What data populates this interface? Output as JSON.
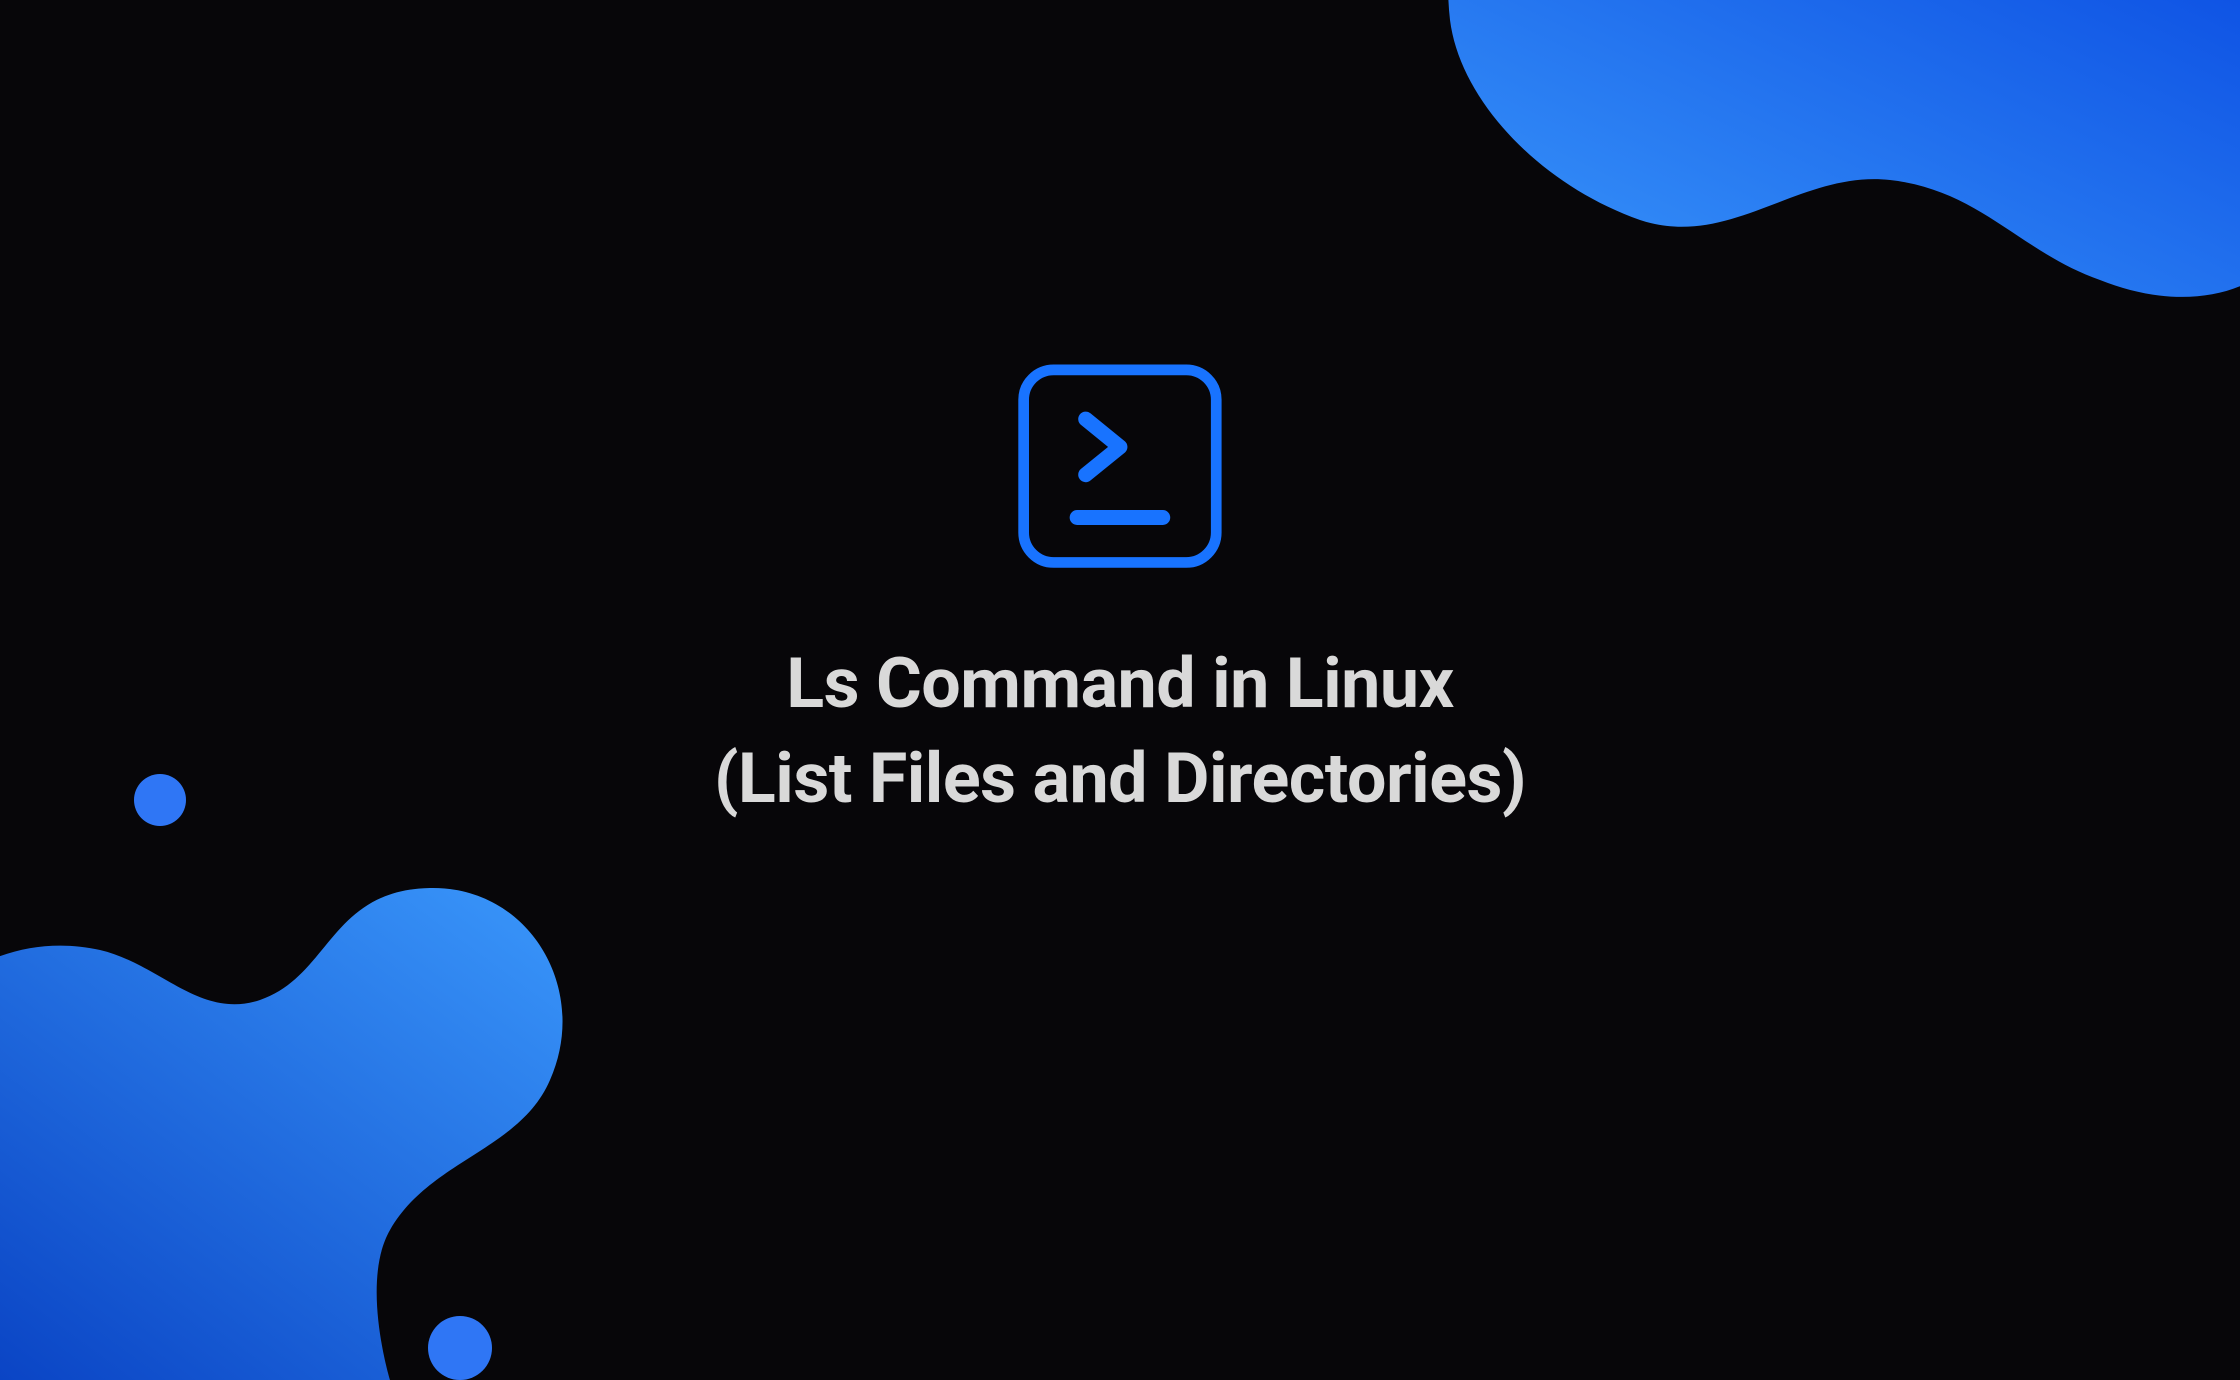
{
  "icon": {
    "name": "terminal-icon",
    "stroke": "#1873ff"
  },
  "title": {
    "line1": "Ls Command in Linux",
    "line2": "(List Files and Directories)"
  },
  "decor": {
    "gradient_from": "#3a97fb",
    "gradient_to": "#0544e0"
  }
}
